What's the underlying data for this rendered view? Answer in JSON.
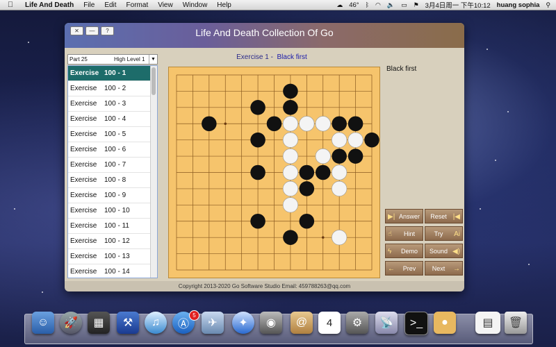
{
  "menubar": {
    "app_name": "Life And Death",
    "menus": [
      "File",
      "Edit",
      "Format",
      "View",
      "Window",
      "Help"
    ],
    "temperature": "46°",
    "date_time": "3月4日周一 下午10:12",
    "user": "huang sophia"
  },
  "window": {
    "title": "Life And Death Collection Of Go",
    "controls": [
      "✕",
      "—",
      "?"
    ]
  },
  "part_selector": {
    "part": "Part 25",
    "level": "High Level 1"
  },
  "exercise_list": [
    {
      "label": "Exercise",
      "num": "100 - 1",
      "selected": true
    },
    {
      "label": "Exercise",
      "num": "100 - 2"
    },
    {
      "label": "Exercise",
      "num": "100 - 3"
    },
    {
      "label": "Exercise",
      "num": "100 - 4"
    },
    {
      "label": "Exercise",
      "num": "100 - 5"
    },
    {
      "label": "Exercise",
      "num": "100 - 6"
    },
    {
      "label": "Exercise",
      "num": "100 - 7"
    },
    {
      "label": "Exercise",
      "num": "100 - 8"
    },
    {
      "label": "Exercise",
      "num": "100 - 9"
    },
    {
      "label": "Exercise",
      "num": "100 - 10"
    },
    {
      "label": "Exercise",
      "num": "100 - 11"
    },
    {
      "label": "Exercise",
      "num": "100 - 12"
    },
    {
      "label": "Exercise",
      "num": "100 - 13"
    },
    {
      "label": "Exercise",
      "num": "100 - 14"
    }
  ],
  "exercise_header": {
    "exercise": "Exercise 1  -",
    "turn": "Black first"
  },
  "status_text": "Black first",
  "board": {
    "stones": [
      {
        "c": "B",
        "col": 7,
        "row": 1
      },
      {
        "c": "B",
        "col": 5,
        "row": 2
      },
      {
        "c": "B",
        "col": 7,
        "row": 2
      },
      {
        "c": "B",
        "col": 2,
        "row": 3
      },
      {
        "c": "B",
        "col": 6,
        "row": 3
      },
      {
        "c": "W",
        "col": 7,
        "row": 3
      },
      {
        "c": "W",
        "col": 8,
        "row": 3
      },
      {
        "c": "W",
        "col": 9,
        "row": 3
      },
      {
        "c": "B",
        "col": 10,
        "row": 3
      },
      {
        "c": "B",
        "col": 11,
        "row": 3
      },
      {
        "c": "B",
        "col": 5,
        "row": 4
      },
      {
        "c": "W",
        "col": 7,
        "row": 4
      },
      {
        "c": "W",
        "col": 10,
        "row": 4
      },
      {
        "c": "W",
        "col": 11,
        "row": 4
      },
      {
        "c": "B",
        "col": 12,
        "row": 4
      },
      {
        "c": "W",
        "col": 7,
        "row": 5
      },
      {
        "c": "W",
        "col": 9,
        "row": 5
      },
      {
        "c": "B",
        "col": 10,
        "row": 5
      },
      {
        "c": "B",
        "col": 11,
        "row": 5
      },
      {
        "c": "B",
        "col": 5,
        "row": 6
      },
      {
        "c": "W",
        "col": 7,
        "row": 6
      },
      {
        "c": "B",
        "col": 8,
        "row": 6
      },
      {
        "c": "B",
        "col": 9,
        "row": 6
      },
      {
        "c": "W",
        "col": 10,
        "row": 6
      },
      {
        "c": "W",
        "col": 7,
        "row": 7
      },
      {
        "c": "B",
        "col": 8,
        "row": 7
      },
      {
        "c": "W",
        "col": 10,
        "row": 7
      },
      {
        "c": "W",
        "col": 7,
        "row": 8
      },
      {
        "c": "B",
        "col": 5,
        "row": 9
      },
      {
        "c": "B",
        "col": 8,
        "row": 9
      },
      {
        "c": "B",
        "col": 7,
        "row": 10
      },
      {
        "c": "W",
        "col": 10,
        "row": 10
      }
    ],
    "star_points": [
      {
        "col": 3,
        "row": 3
      },
      {
        "col": 9,
        "row": 3
      },
      {
        "col": 9,
        "row": 10
      }
    ]
  },
  "controls": {
    "answer": "Answer",
    "reset": "Reset",
    "hint": "Hint",
    "try": "Try",
    "demo": "Demo",
    "sound": "Sound",
    "prev": "Prev",
    "next": "Next"
  },
  "copyright": "Copyright 2013-2020 Go Software Studio Email: 459788263@qq.com",
  "dock_badge": "5",
  "calendar_day": "4",
  "colors": {
    "selected_row": "#1d6c6a",
    "board": "#f6c46c",
    "button": "#8d6a4c",
    "header_text": "#2a2a8a"
  }
}
